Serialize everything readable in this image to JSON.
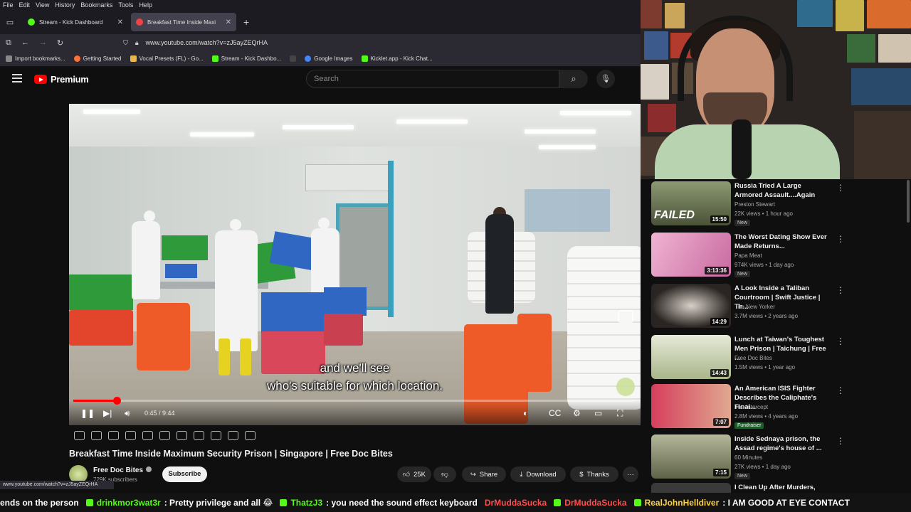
{
  "browser": {
    "menu": [
      "File",
      "Edit",
      "View",
      "History",
      "Bookmarks",
      "Tools",
      "Help"
    ],
    "tabs": [
      {
        "label": "Stream - Kick Dashboard",
        "active": false
      },
      {
        "label": "Breakfast Time Inside Maxi",
        "active": true
      }
    ],
    "url": "www.youtube.com/watch?v=zJ5ayZEQrHA",
    "bookmarks": [
      {
        "label": "Import bookmarks...",
        "color": "#888888"
      },
      {
        "label": "Getting Started",
        "color": "#ff7139"
      },
      {
        "label": "Vocal Presets (FL) - Go...",
        "color": "#e8b84a"
      },
      {
        "label": "Stream - Kick Dashbo...",
        "color": "#53fc18"
      },
      {
        "label": "",
        "color": "#444444"
      },
      {
        "label": "Google Images",
        "color": "#4285f4"
      },
      {
        "label": "Kicklet.app - Kick Chat...",
        "color": "#53fc18"
      }
    ],
    "status_url": "www.youtube.com/watch?v=zJ5ayZEQrHA"
  },
  "youtube": {
    "brand": "Premium",
    "search_placeholder": "Search"
  },
  "video": {
    "subtitle_line1": "and we'll see",
    "subtitle_line2": "who's suitable for which location.",
    "time": "0:45 / 9:44",
    "progress": 0.077,
    "title": "Breakfast Time Inside Maximum Security Prison | Singapore | Free Doc Bites",
    "channel": "Free Doc Bites",
    "subscribers": "729K subscribers",
    "subscribe_label": "Subscribe",
    "likes": "25K",
    "share_label": "Share",
    "download_label": "Download",
    "thanks_label": "Thanks",
    "more_label": "···"
  },
  "recommendations": [
    {
      "title": "Russia Tried A Large Armored Assault....Again",
      "channel": "Preston Stewart",
      "meta": "22K views • 1 hour ago",
      "duration": "15:50",
      "badge": "New",
      "thumb_text": "FAILED",
      "thumb_bg": "#5d6b4a"
    },
    {
      "title": "The Worst Dating Show Ever Made Returns...",
      "channel": "Papa Meat",
      "meta": "974K views • 1 day ago",
      "duration": "3:13:36",
      "badge": "New",
      "thumb_text": "",
      "thumb_bg": "#e29bc0"
    },
    {
      "title": "A Look Inside a Taliban Courtroom | Swift Justice | Th...",
      "channel": "The New Yorker",
      "meta": "3.7M views • 2 years ago",
      "duration": "14:29",
      "badge": "",
      "thumb_text": "",
      "thumb_bg": "#3a3532"
    },
    {
      "title": "Lunch at Taiwan's Toughest Men Prison | Taichung | Free ...",
      "channel": "Free Doc Bites",
      "meta": "1.5M views • 1 year ago",
      "duration": "14:43",
      "badge": "",
      "thumb_text": "",
      "thumb_bg": "#c9d3c0"
    },
    {
      "title": "An American ISIS Fighter Describes the Caliphate's Final...",
      "channel": "The Intercept",
      "meta": "2.8M views • 4 years ago",
      "duration": "7:07",
      "badge": "Fundraiser",
      "thumb_text": "",
      "thumb_bg": "#c7425a"
    },
    {
      "title": "Inside Sednaya prison, the Assad regime's house of ...",
      "channel": "60 Minutes",
      "meta": "27K views • 1 day ago",
      "duration": "7:15",
      "badge": "New",
      "thumb_text": "",
      "thumb_bg": "#7d8466"
    },
    {
      "title": "I Clean Up After Murders, Meth",
      "channel": "",
      "meta": "",
      "duration": "",
      "badge": "",
      "thumb_text": "",
      "thumb_bg": "#444444"
    }
  ],
  "ticker": [
    {
      "user": "",
      "msg": "ends on the person"
    },
    {
      "user": "drinkmor3wat3r",
      "msg": ": Pretty privilege and all 😂"
    },
    {
      "user": "ThatzJ3",
      "msg": ": you need the sound effect keyboard"
    },
    {
      "user": "DrMuddaSucka",
      "msg": ""
    },
    {
      "user": "DrMuddaSucka",
      "msg": ""
    },
    {
      "user": "RealJohnHelldiver",
      "msg": ": I AM GOOD AT EYE CONTACT"
    }
  ]
}
